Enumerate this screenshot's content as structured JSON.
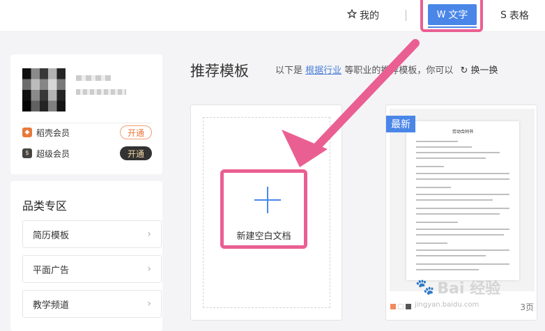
{
  "topbar": {
    "mine_label": "我的",
    "doc_tab_label": "文字",
    "sheet_tab_label": "表格"
  },
  "user": {
    "members": [
      {
        "label": "稻壳会员",
        "button": "开通",
        "icon_color": "#e8783a"
      },
      {
        "label": "超级会员",
        "button": "开通",
        "icon_color": "#444444"
      }
    ]
  },
  "categories": {
    "title": "品类专区",
    "items": [
      "简历模板",
      "平面广告",
      "教学频道"
    ]
  },
  "main": {
    "section_title": "推荐模板",
    "hint_prefix": "以下是",
    "hint_link": "根据行业",
    "hint_suffix": "等职业的推荐模板，你可以",
    "swap_label": "换一换",
    "new_blank_label": "新建空白文档",
    "template": {
      "badge": "最新",
      "doc_title": "劳动合同书",
      "pages": "3页"
    }
  },
  "colors": {
    "accent": "#4a86e8",
    "highlight": "#ea5f92"
  },
  "watermark": {
    "text": "Bai 经验",
    "sub": "jingyan.baidu.com"
  }
}
